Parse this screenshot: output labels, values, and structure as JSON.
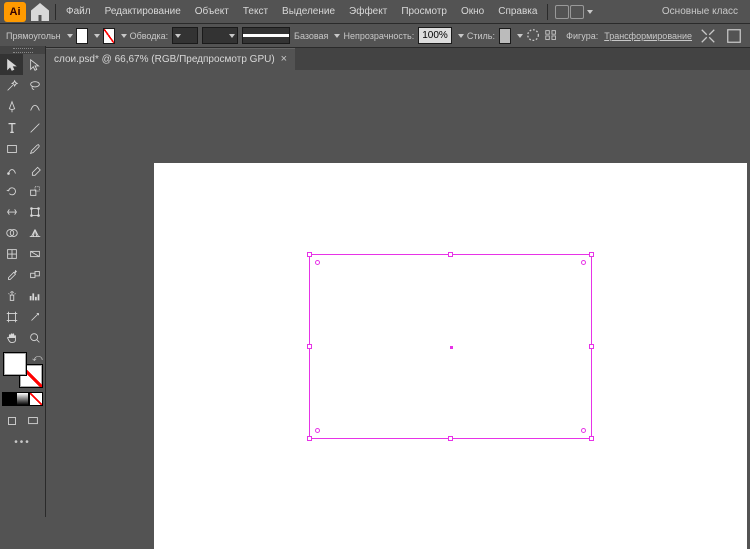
{
  "app": {
    "logo_text": "Ai"
  },
  "menu": [
    "Файл",
    "Редактирование",
    "Объект",
    "Текст",
    "Выделение",
    "Эффект",
    "Просмотр",
    "Окно",
    "Справка"
  ],
  "menu_right": "Основные класс",
  "ctrl": {
    "shape": "Прямоугольн",
    "stroke_lbl": "Обводка:",
    "stroke_style": "Базовая",
    "opacity_lbl": "Непрозрачность:",
    "opacity_val": "100%",
    "style_lbl": "Стиль:",
    "shape_lbl": "Фигура:",
    "transform_lbl": "Трансформирование"
  },
  "doc": {
    "tab": "слои.psd* @ 66,67% (RGB/Предпросмотр GPU)"
  },
  "tools_more": "•••"
}
